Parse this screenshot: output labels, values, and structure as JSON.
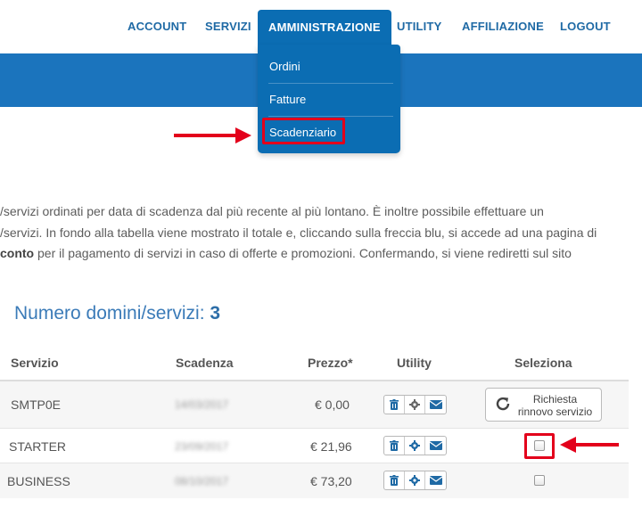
{
  "nav": {
    "items": [
      "ACCOUNT",
      "SERVIZI",
      "AMMINISTRAZIONE",
      "UTILITY",
      "AFFILIAZIONE",
      "LOGOUT"
    ],
    "active": "AMMINISTRAZIONE"
  },
  "dropdown": {
    "items": [
      "Ordini",
      "Fatture",
      "Scadenziario"
    ],
    "highlighted": "Scadenziario"
  },
  "intro": {
    "line1": "/servizi ordinati per data di scadenza dal più recente al più lontano. È inoltre possibile effettuare un",
    "line2": "/servizi. In fondo alla tabella viene mostrato il totale e, cliccando sulla freccia blu, si accede ad una pagina di",
    "line3_bold": "conto",
    "line3_rest": " per il pagamento di servizi in caso di offerte e promozioni. Confermando, si viene rediretti sul sito"
  },
  "count": {
    "label": "Numero domini/servizi: ",
    "value": "3"
  },
  "table": {
    "headers": [
      "Servizio",
      "Scadenza",
      "Prezzo*",
      "Utility",
      "Seleziona"
    ],
    "rows": [
      {
        "servizio": "SMTP0E",
        "scadenza": "14/03/2017",
        "prezzo": "€ 0,00"
      },
      {
        "servizio": "STARTER",
        "scadenza": "23/09/2017",
        "prezzo": "€ 21,96"
      },
      {
        "servizio": "BUSINESS",
        "scadenza": "08/10/2017",
        "prezzo": "€ 73,20"
      }
    ],
    "renew_button": {
      "line1": "Richiesta",
      "line2": "rinnovo servizio"
    }
  },
  "colors": {
    "accent": "#0b6db3",
    "band": "#1b74bd",
    "annotation": "#e3001b"
  },
  "icons": [
    "trash-icon",
    "gear-icon",
    "envelope-icon",
    "refresh-icon",
    "arrow-icon"
  ]
}
